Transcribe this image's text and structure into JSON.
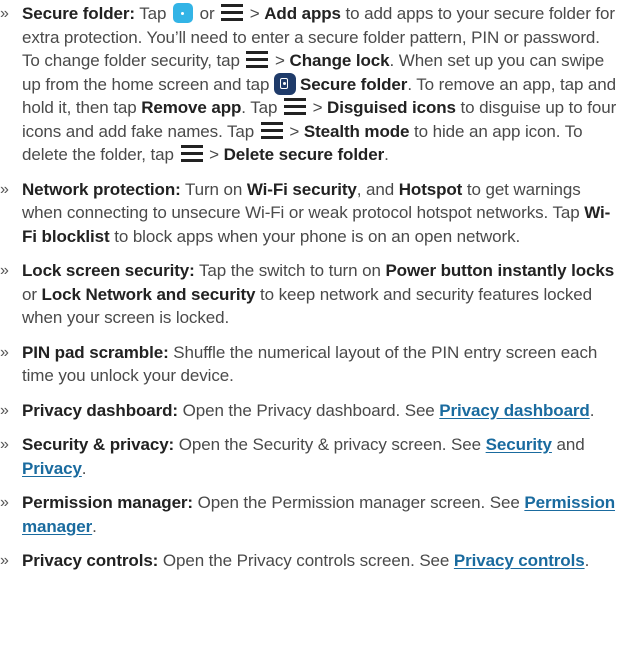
{
  "bullet": "»",
  "colors": {
    "text": "#4a4a4a",
    "bold": "#222222",
    "link": "#1a6b9f",
    "add_icon": "#33b4e6",
    "secure_folder_icon": "#1f3b6a"
  },
  "icons": {
    "menu": "menu-icon",
    "add": "add-app-icon",
    "secure_folder": "secure-folder-icon"
  },
  "items": [
    {
      "title": "Secure folder:",
      "t1": " Tap ",
      "t2": " or ",
      "t3": " > ",
      "b1": "Add apps",
      "t4": " to add apps to your secure folder for extra protection. You’ll need to enter a secure folder pattern, PIN or password. To change folder security, tap ",
      "t5": " > ",
      "b2": "Change lock",
      "t6": ". When set up you can swipe up from the home screen and tap ",
      "b3": "Secure folder",
      "t7": ". To remove an app, tap and hold it, then tap ",
      "b4": "Remove app",
      "t8": ". Tap ",
      "t9": " > ",
      "b5": "Disguised icons",
      "t10": " to disguise up to four icons and add fake names. Tap ",
      "t11": " > ",
      "b6": "Stealth mode",
      "t12": " to hide an app icon. To delete the folder, tap ",
      "t13": " > ",
      "b7": "Delete secure folder",
      "t14": "."
    },
    {
      "title": "Network protection:",
      "t1": " Turn on ",
      "b1": "Wi-Fi security",
      "t2": ", and ",
      "b2": "Hotspot",
      "t3": " to get warnings when connecting to unsecure Wi-Fi or weak protocol hotspot networks. Tap ",
      "b3": "Wi-Fi blocklist",
      "t4": " to block apps when your phone is on an open network."
    },
    {
      "title": "Lock screen security:",
      "t1": " Tap the switch to turn on ",
      "b1": "Power button instantly locks",
      "t2": " or ",
      "b2": "Lock Network and security",
      "t3": " to keep network and security features locked when your screen is locked."
    },
    {
      "title": "PIN pad scramble:",
      "t1": " Shuffle the numerical layout of the PIN entry screen each time you unlock your device."
    },
    {
      "title": "Privacy dashboard:",
      "t1": " Open the Privacy dashboard. See ",
      "link1": "Privacy dashboard",
      "t2": "."
    },
    {
      "title": "Security & privacy:",
      "t1": " Open the Security & privacy screen. See ",
      "link1": "Security",
      "t2": " and ",
      "link2": "Privacy",
      "t3": "."
    },
    {
      "title": "Permission manager:",
      "t1": " Open the Permission manager screen. See ",
      "link1": "Permission manager",
      "t2": "."
    },
    {
      "title": "Privacy controls:",
      "t1": " Open the Privacy controls screen. See ",
      "link1": "Privacy controls",
      "t2": "."
    }
  ]
}
